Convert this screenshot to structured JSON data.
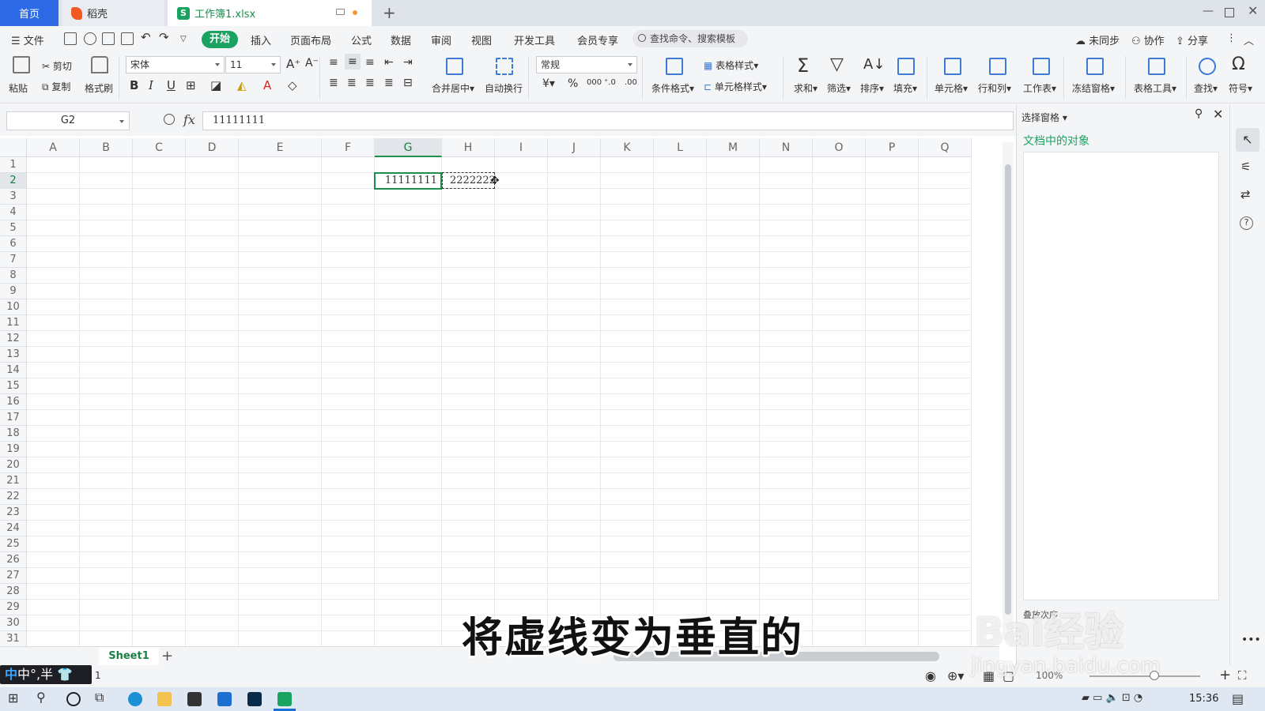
{
  "tabs": {
    "home": "首页",
    "daoke": "稻壳",
    "workbook": "工作簿1.xlsx"
  },
  "menu": {
    "file": "文件",
    "items": [
      "开始",
      "插入",
      "页面布局",
      "公式",
      "数据",
      "审阅",
      "视图",
      "开发工具",
      "会员专享"
    ],
    "search": "查找命令、搜索模板",
    "sync": "未同步",
    "collab": "协作",
    "share": "分享"
  },
  "toolbar": {
    "paste": "粘贴",
    "cut": "剪切",
    "copy": "复制",
    "format_painter": "格式刷",
    "font": "宋体",
    "size": "11",
    "merge": "合并居中",
    "wrap": "自动换行",
    "number_format": "常规",
    "cond_format": "条件格式",
    "table_style": "表格样式",
    "cell_style": "单元格样式",
    "sum": "求和",
    "filter": "筛选",
    "sort": "排序",
    "fill": "填充",
    "cells": "单元格",
    "rowcol": "行和列",
    "sheet": "工作表",
    "freeze": "冻结窗格",
    "tools": "表格工具",
    "find": "查找",
    "symbol": "符号",
    "bold": "B",
    "italic": "I",
    "underline": "U"
  },
  "formula": {
    "cell_ref": "G2",
    "fx": "fx",
    "value": "11111111"
  },
  "columns": [
    "A",
    "B",
    "C",
    "D",
    "E",
    "F",
    "G",
    "H",
    "I",
    "J",
    "K",
    "L",
    "M",
    "N",
    "O",
    "P",
    "Q"
  ],
  "rows": [
    "1",
    "2",
    "3",
    "4",
    "5",
    "6",
    "7",
    "8",
    "9",
    "10",
    "11",
    "12",
    "13",
    "14",
    "15",
    "16",
    "17",
    "18",
    "19",
    "20",
    "21",
    "22",
    "23",
    "24",
    "25",
    "26",
    "27",
    "28",
    "29",
    "30",
    "31"
  ],
  "cells": {
    "g2": "11111111",
    "h2": "2222222"
  },
  "sheets": {
    "active": "Sheet1"
  },
  "pane": {
    "title": "选择窗格",
    "subtitle": "文档中的对象",
    "footer": "叠放次序"
  },
  "status": {
    "ime": "中°,半",
    "page": "1",
    "zoom": "100%"
  },
  "taskbar": {
    "clock": "15:36"
  },
  "subtitle": "将虚线变为垂直的",
  "watermark": {
    "brand": "Bai经验",
    "url": "jingyan.baidu.com"
  }
}
